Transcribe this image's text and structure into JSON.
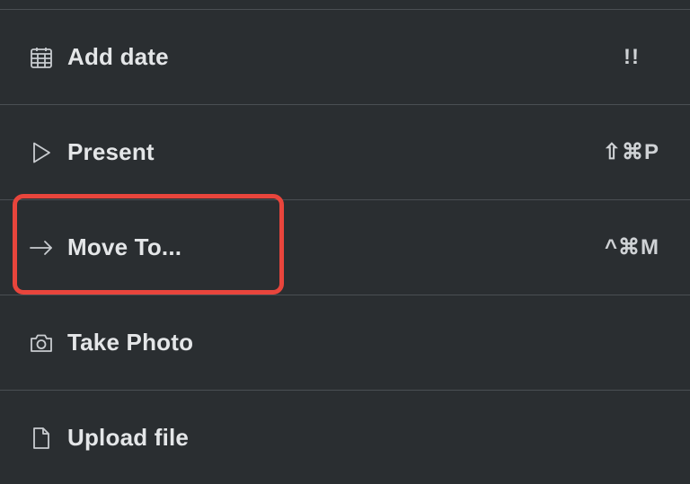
{
  "menu": {
    "items": [
      {
        "icon": "calendar-icon",
        "label": "Add date",
        "shortcut": "!!"
      },
      {
        "icon": "play-icon",
        "label": "Present",
        "shortcut": "⇧⌘P"
      },
      {
        "icon": "arrow-right-icon",
        "label": "Move To...",
        "shortcut": "^⌘M"
      },
      {
        "icon": "camera-icon",
        "label": "Take Photo",
        "shortcut": ""
      },
      {
        "icon": "file-icon",
        "label": "Upload file",
        "shortcut": ""
      }
    ]
  },
  "colors": {
    "background": "#2a2e31",
    "divider": "#4a4f53",
    "text": "#e4e6e8",
    "highlight": "#e8453c"
  }
}
